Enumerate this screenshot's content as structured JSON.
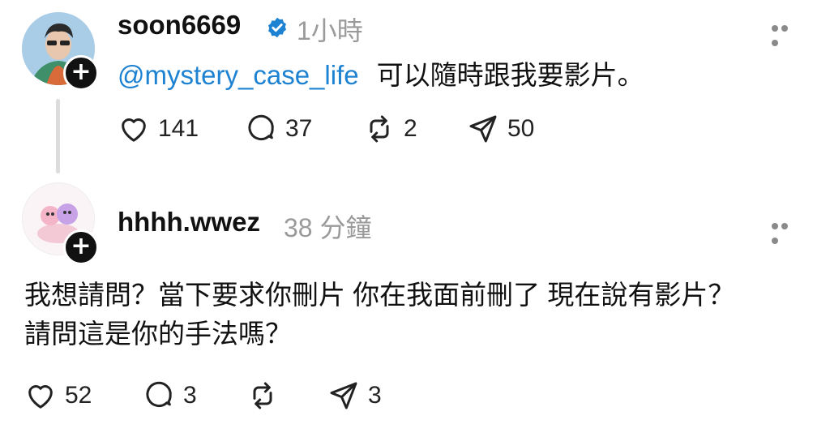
{
  "post": {
    "username": "soon6669",
    "time": "1小時",
    "mention": "@mystery_case_life",
    "text": "可以隨時跟我要影片。",
    "likes": "141",
    "comments": "37",
    "reposts": "2",
    "shares": "50"
  },
  "reply": {
    "username": "hhhh.wwez",
    "time": "38 分鐘",
    "text": "我想請問？當下要求你刪片 你在我面前刪了 現在說有影片？\n請問這是你的手法嗎？",
    "likes": "52",
    "comments": "3",
    "reposts": "",
    "shares": "3"
  },
  "icons": {
    "verified": "verified-badge-icon",
    "follow": "plus-icon",
    "more": "more-icon",
    "like": "heart-icon",
    "comment": "comment-bubble-icon",
    "repost": "repost-icon",
    "share": "send-icon"
  },
  "colors": {
    "mention": "#1d82d1",
    "verified": "#1d82d1",
    "timestamp": "#9a9a9a"
  }
}
